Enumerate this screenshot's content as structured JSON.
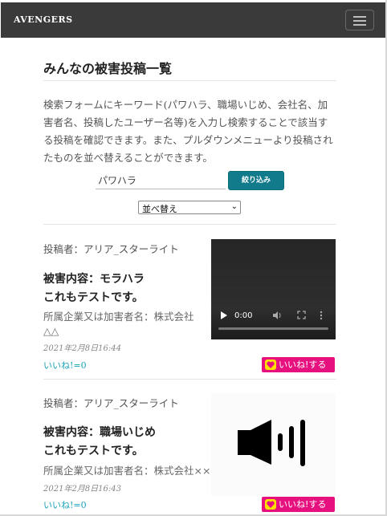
{
  "navbar": {
    "brand": "AVENGERS"
  },
  "page": {
    "title": "みんなの被害投稿一覧",
    "description": "検索フォームにキーワード(パワハラ、職場いじめ、会社名、加害者名、投稿したユーザー名等)を入力し検索することで該当する投稿を確認できます。また、プルダウンメニューより投稿されたものを並べ替えることができます。"
  },
  "search": {
    "value": "パワハラ",
    "button_label": "絞り込み"
  },
  "sort": {
    "selected": "並べ替え"
  },
  "posts": [
    {
      "poster": "投稿者：アリア_スターライト",
      "damage_label": "被害内容：モラハラ",
      "body": "これもテストです。",
      "company": "所属企業又は加害者名：株式会社△△",
      "date": "2021年2月8日16:44",
      "likes": "いいね!=0",
      "like_button": "いいね!する",
      "media": {
        "type": "video",
        "time": "0:00"
      }
    },
    {
      "poster": "投稿者：アリア_スターライト",
      "damage_label": "被害内容：職場いじめ",
      "body": "これもテストです。",
      "company": "所属企業又は加害者名：株式会社××",
      "date": "2021年2月8日16:43",
      "likes": "いいね!=0",
      "like_button": "いいね!する",
      "media": {
        "type": "audio-icon"
      }
    }
  ],
  "colors": {
    "navbar": "#3a3a3a",
    "filter_button": "#117a8b",
    "like_button": "#e6117e",
    "like_heart_bg": "#ffe100",
    "likes_text": "#17a2b8"
  },
  "icons": [
    "hamburger-icon",
    "heart-icon",
    "play-icon",
    "volume-icon",
    "fullscreen-icon",
    "more-options-icon",
    "speaker-icon"
  ]
}
